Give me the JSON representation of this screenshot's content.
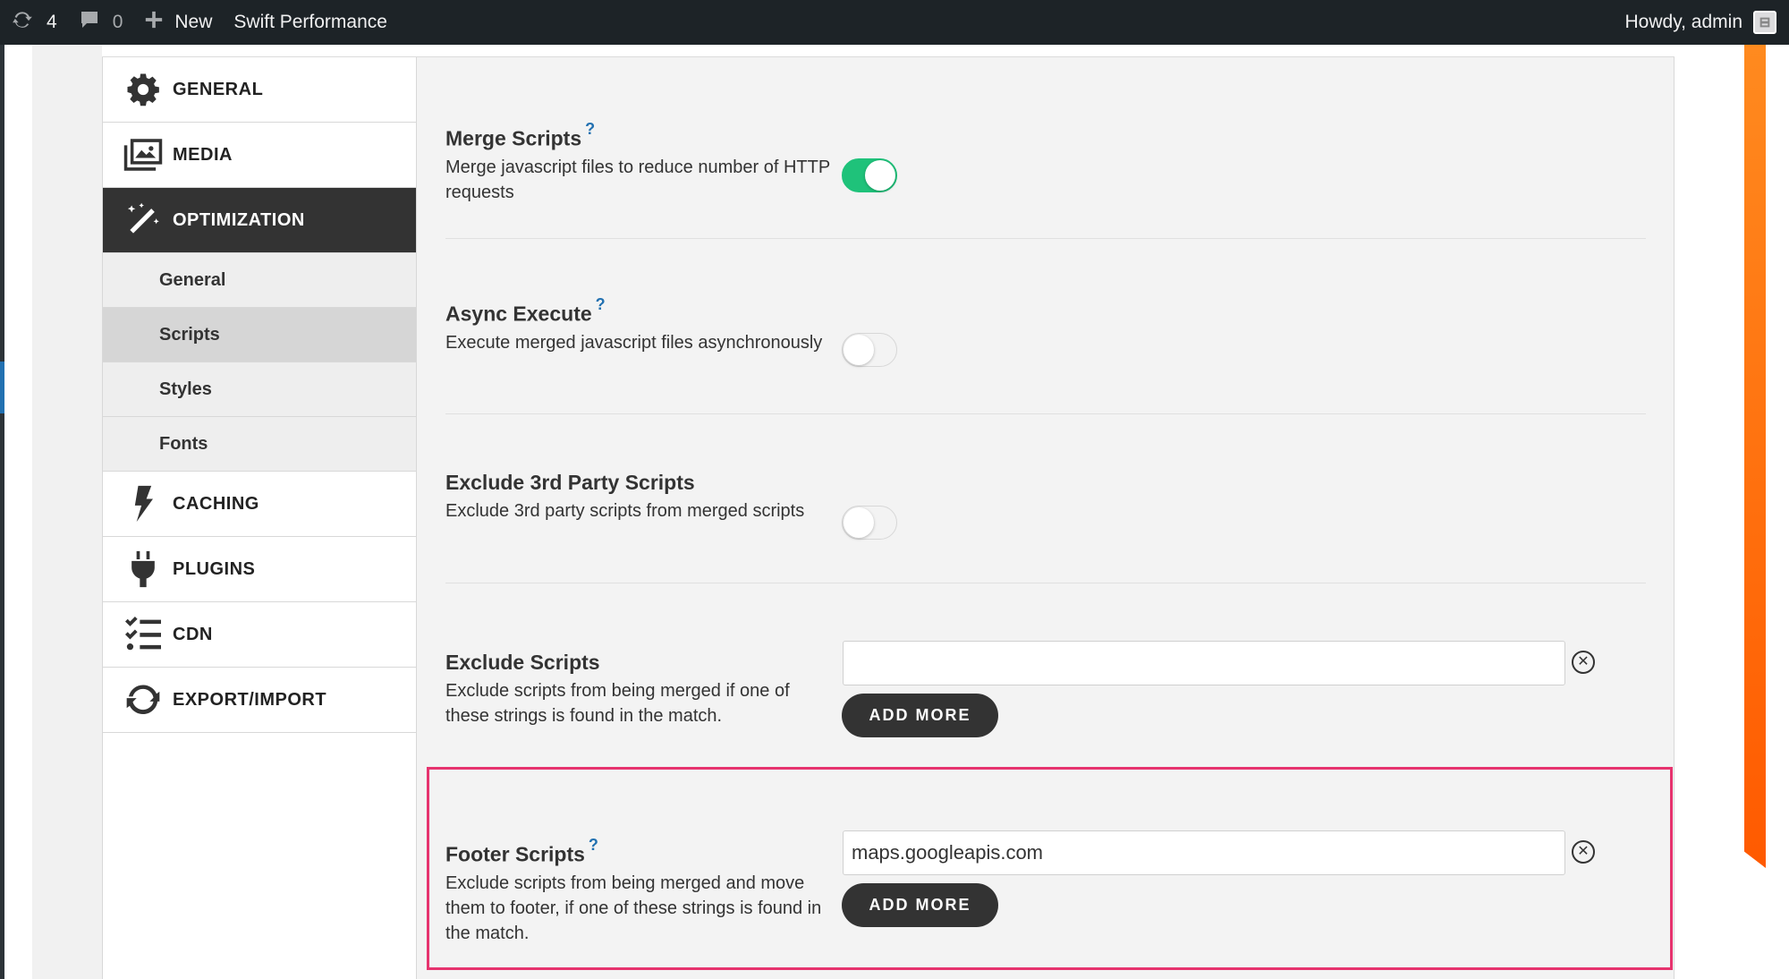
{
  "adminbar": {
    "updates_count": "4",
    "comments_count": "0",
    "new_label": "New",
    "site_label": "Swift Performance",
    "greeting": "Howdy, admin"
  },
  "sidebar": {
    "items": [
      {
        "label": "GENERAL",
        "icon": "gear-icon"
      },
      {
        "label": "MEDIA",
        "icon": "images-icon"
      },
      {
        "label": "OPTIMIZATION",
        "icon": "magic-wand-icon"
      },
      {
        "label": "CACHING",
        "icon": "lightning-icon"
      },
      {
        "label": "PLUGINS",
        "icon": "plug-icon"
      },
      {
        "label": "CDN",
        "icon": "checklist-icon"
      },
      {
        "label": "EXPORT/IMPORT",
        "icon": "sync-icon"
      }
    ],
    "subitems": [
      "General",
      "Scripts",
      "Styles",
      "Fonts"
    ],
    "active_item": "OPTIMIZATION",
    "current_subitem": "Scripts"
  },
  "options": {
    "merge_scripts": {
      "title": "Merge Scripts",
      "help": "?",
      "desc": "Merge javascript files to reduce number of HTTP requests",
      "enabled": true
    },
    "async_execute": {
      "title": "Async Execute",
      "help": "?",
      "desc": "Execute merged javascript files asynchronously",
      "enabled": false
    },
    "exclude_3rd_party": {
      "title": "Exclude 3rd Party Scripts",
      "desc": "Exclude 3rd party scripts from merged scripts",
      "enabled": false
    },
    "exclude_scripts": {
      "title": "Exclude Scripts",
      "desc": "Exclude scripts from being merged if one of these strings is found in the match.",
      "value": "",
      "add_label": "ADD MORE"
    },
    "footer_scripts": {
      "title": "Footer Scripts",
      "help": "?",
      "desc": "Exclude scripts from being merged and move them to footer, if one of these strings is found in the match.",
      "value": "maps.googleapis.com",
      "add_label": "ADD MORE"
    }
  },
  "colors": {
    "toggle_on": "#1fc27a",
    "highlight": "#e6336e",
    "accent_blue": "#2271b1"
  }
}
